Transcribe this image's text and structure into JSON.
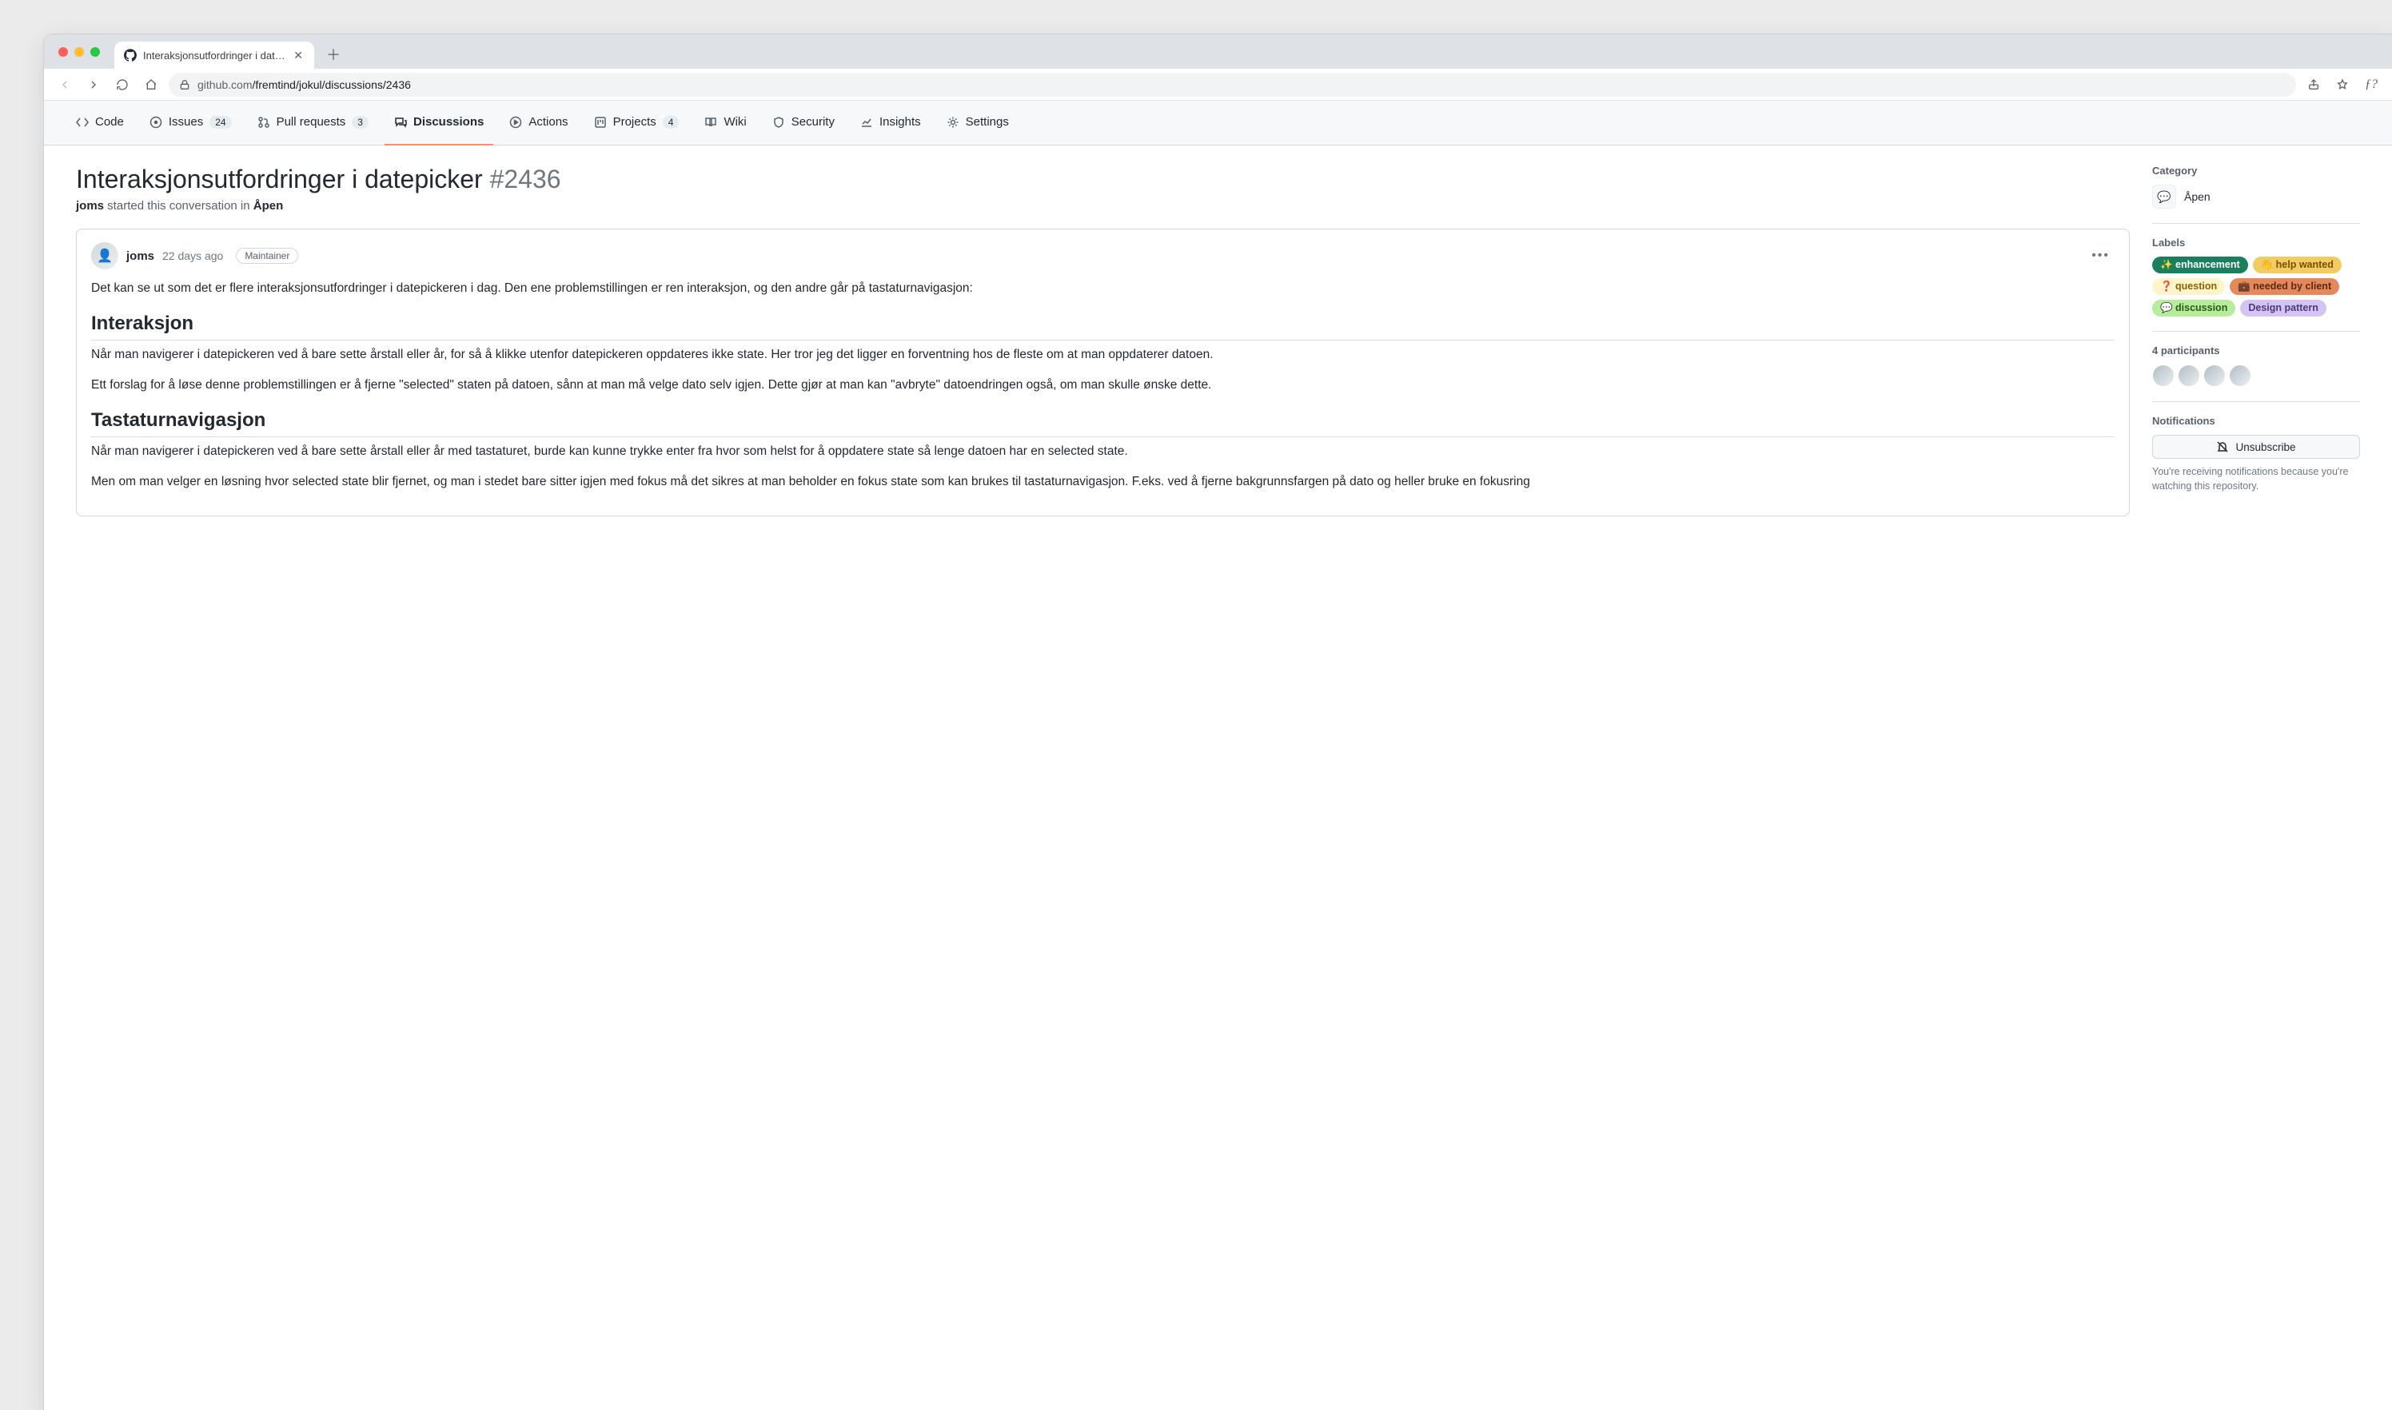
{
  "browser": {
    "tab_title": "Interaksjonsutfordringer i datep",
    "url_host": "github.com",
    "url_path": "/fremtind/jokul/discussions/2436"
  },
  "reponav": {
    "code": "Code",
    "issues": "Issues",
    "issues_count": "24",
    "pulls": "Pull requests",
    "pulls_count": "3",
    "discussions": "Discussions",
    "actions": "Actions",
    "projects": "Projects",
    "projects_count": "4",
    "wiki": "Wiki",
    "security": "Security",
    "insights": "Insights",
    "settings": "Settings"
  },
  "discussion": {
    "title": "Interaksjonsutfordringer i datepicker",
    "number": "#2436",
    "starter": "joms",
    "starter_text": " started this conversation in ",
    "channel": "Åpen"
  },
  "post": {
    "author": "joms",
    "when": "22 days ago",
    "badge": "Maintainer",
    "p_intro": "Det kan se ut som det er flere interaksjonsutfordringer i datepickeren i dag. Den ene problemstillingen er ren interaksjon, og den andre går på tastaturnavigasjon:",
    "h_inter": "Interaksjon",
    "p_inter1": "Når man navigerer i datepickeren ved å bare sette årstall eller år, for så å klikke utenfor datepickeren oppdateres ikke state. Her tror jeg det ligger en forventning hos de fleste om at man oppdaterer datoen.",
    "p_inter2": "Ett forslag for å løse denne problemstillingen er å fjerne \"selected\" staten på datoen, sånn at man må velge dato selv igjen. Dette gjør at man kan \"avbryte\" datoendringen også, om man skulle ønske dette.",
    "h_keys": "Tastaturnavigasjon",
    "p_keys1": "Når man navigerer i datepickeren ved å bare sette årstall eller år med tastaturet, burde kan kunne trykke enter fra hvor som helst for å oppdatere state så lenge datoen har en selected state.",
    "p_keys2": "Men om man velger en løsning hvor selected state blir fjernet, og man i stedet bare sitter igjen med fokus må det sikres at man beholder en fokus state som kan brukes til tastaturnavigasjon. F.eks. ved å fjerne bakgrunnsfargen på dato og heller bruke en fokusring"
  },
  "sidebar": {
    "category_h": "Category",
    "category": "Åpen",
    "labels_h": "Labels",
    "labels": [
      {
        "emoji": "✨",
        "text": "enhancement",
        "bg": "#1a7f5c",
        "fg": "#ffffff"
      },
      {
        "emoji": "👋",
        "text": "help wanted",
        "bg": "#f2cc60",
        "fg": "#7a4f00"
      },
      {
        "emoji": "❓",
        "text": "question",
        "bg": "#fff4c9",
        "fg": "#8a6400"
      },
      {
        "emoji": "💼",
        "text": "needed by client",
        "bg": "#e5895c",
        "fg": "#5a2a0e"
      },
      {
        "emoji": "💬",
        "text": "discussion",
        "bg": "#b7ec9d",
        "fg": "#245a13"
      },
      {
        "emoji": "",
        "text": "Design pattern",
        "bg": "#d4c4f4",
        "fg": "#4b3a7a"
      }
    ],
    "participants_h": "4 participants",
    "notifications_h": "Notifications",
    "unsubscribe": "Unsubscribe",
    "notif_note": "You're receiving notifications because you're watching this repository."
  }
}
